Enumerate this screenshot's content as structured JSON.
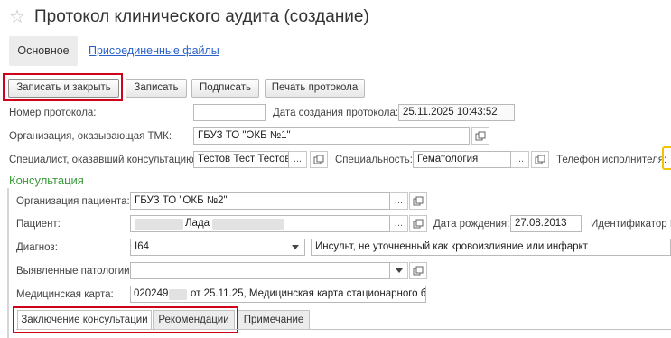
{
  "window": {
    "title": "Протокол клинического аудита (создание)"
  },
  "tabs_top": {
    "main": "Основное",
    "files": "Присоединенные файлы"
  },
  "toolbar": {
    "save_close": "Записать и закрыть",
    "save": "Записать",
    "sign": "Подписать",
    "print": "Печать протокола"
  },
  "form": {
    "protocol_number_label": "Номер протокола:",
    "protocol_number_value": "",
    "created_label": "Дата создания протокола:",
    "created_value": "25.11.2025 10:43:52",
    "org_tmk_label": "Организация, оказывающая ТМК:",
    "org_tmk_value": "ГБУЗ ТО \"ОКБ №1\"",
    "specialist_label": "Специалист, оказавший консультацию:",
    "specialist_value": "Тестов Тест Тестов",
    "specialty_label": "Специальность:",
    "specialty_value": "Гематология",
    "phone_label": "Телефон исполнителя:"
  },
  "consultation": {
    "section_title": "Консультация",
    "patient_org_label": "Организация пациента:",
    "patient_org_value": "ГБУЗ ТО \"ОКБ №2\"",
    "patient_label": "Пациент:",
    "patient_value": "Лада",
    "birth_label": "Дата рождения:",
    "birth_value": "27.08.2013",
    "identifier_label": "Идентификатор Р",
    "diagnosis_label": "Диагноз:",
    "diagnosis_code": "I64",
    "diagnosis_text": "Инсульт, не уточненный как кровоизлияние или инфаркт",
    "pathologies_label": "Выявленные патологии:",
    "pathologies_value": "",
    "card_label": "Медицинская карта:",
    "card_value_prefix": "020249",
    "card_value_suffix": "от 25.11.25, Медицинская карта стационарного бо"
  },
  "bottom_tabs": {
    "conclusion": "Заключение консультации",
    "recommendations": "Рекомендации",
    "note": "Примечание"
  },
  "icons": {
    "select": "ellipsis",
    "open": "open-form-icon",
    "dropdown": "chevron-down-icon",
    "favorite": "star-icon"
  },
  "colors": {
    "section_title": "#3a9a3a",
    "link": "#2a62c9",
    "highlight_box": "#d0021b",
    "phone_field_edge": "#f2c200"
  }
}
